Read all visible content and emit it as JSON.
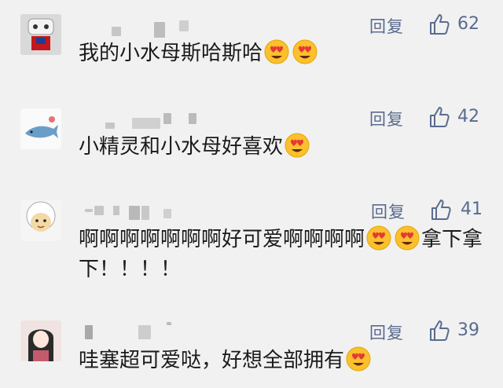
{
  "reply_label": "回复",
  "comments": [
    {
      "likes": "62",
      "text": "我的小水母斯哈斯哈",
      "emojis": 2
    },
    {
      "likes": "42",
      "text": "小精灵和小水母好喜欢",
      "emojis": 1
    },
    {
      "likes": "41",
      "text": "啊啊啊啊啊啊啊好可爱啊啊啊啊",
      "emojis": 2,
      "tail": "拿下拿下！！！！"
    },
    {
      "likes": "39",
      "text": "哇塞超可爱哒，好想全部拥有",
      "emojis": 1
    }
  ],
  "icons": {
    "like": "thumbs-up-icon",
    "emoji": "heart-eyes-emoji"
  },
  "colors": {
    "background": "#f1f1f1",
    "link": "#5a6b8f",
    "text": "#1a1a1a"
  }
}
